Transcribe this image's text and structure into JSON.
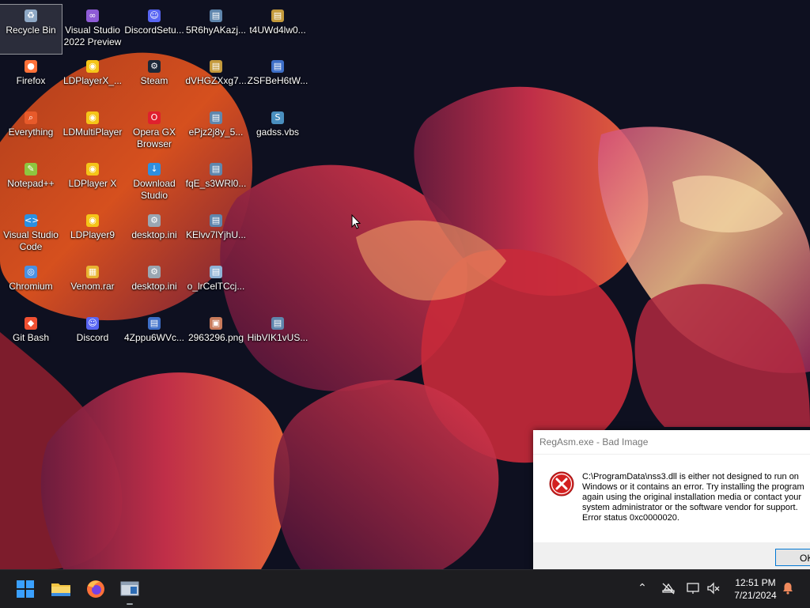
{
  "desktop": {
    "icons": [
      {
        "label": "Recycle Bin",
        "icon": "recycle-bin-icon",
        "color": "#8fa9c6",
        "selected": true
      },
      {
        "label": "Visual Studio\n2022 Preview",
        "icon": "visual-studio-icon",
        "color": "#8e5bd6"
      },
      {
        "label": "DiscordSetu...",
        "icon": "discord-icon",
        "color": "#5865f2"
      },
      {
        "label": "5R6hyAKazj...",
        "icon": "file-icon",
        "color": "#5f86ad"
      },
      {
        "label": "t4UWd4lw0...",
        "icon": "file-icon",
        "color": "#c49a3c"
      },
      {
        "label": "Firefox",
        "icon": "firefox-icon",
        "color": "#ff7139"
      },
      {
        "label": "LDPlayerX_...",
        "icon": "ldplayer-icon",
        "color": "#f5c518"
      },
      {
        "label": "Steam",
        "icon": "steam-icon",
        "color": "#1b2838"
      },
      {
        "label": "dVHGZXxg7...",
        "icon": "file-icon",
        "color": "#c49a3c"
      },
      {
        "label": "ZSFBeH6tW...",
        "icon": "file-icon",
        "color": "#3e6fc8"
      },
      {
        "label": "Everything",
        "icon": "everything-icon",
        "color": "#e85a2a"
      },
      {
        "label": "LDMultiPlayer",
        "icon": "ldmultiplayer-icon",
        "color": "#f5c518"
      },
      {
        "label": "Opera GX\nBrowser",
        "icon": "opera-gx-icon",
        "color": "#e0202e"
      },
      {
        "label": "ePjz2j8y_5...",
        "icon": "file-icon",
        "color": "#5f86ad"
      },
      {
        "label": "gadss.vbs",
        "icon": "script-icon",
        "color": "#4a8fbf"
      },
      {
        "label": "Notepad++",
        "icon": "notepad-plus-plus-icon",
        "color": "#8ec63f"
      },
      {
        "label": "LDPlayer X",
        "icon": "ldplayer-icon",
        "color": "#f5c518"
      },
      {
        "label": "Download\nStudio",
        "icon": "download-studio-icon",
        "color": "#2f8fe0"
      },
      {
        "label": "fqE_s3WRl0...",
        "icon": "file-icon",
        "color": "#5f86ad"
      },
      {
        "label": "",
        "icon": "",
        "color": ""
      },
      {
        "label": "Visual Studio\nCode",
        "icon": "vscode-icon",
        "color": "#2b8fe0"
      },
      {
        "label": "LDPlayer9",
        "icon": "ldplayer-icon",
        "color": "#f5c518"
      },
      {
        "label": "desktop.ini",
        "icon": "settings-file-icon",
        "color": "#9aa6b2"
      },
      {
        "label": "KElvv7lYjhU...",
        "icon": "file-icon",
        "color": "#5f86ad"
      },
      {
        "label": "",
        "icon": "",
        "color": ""
      },
      {
        "label": "Chromium",
        "icon": "chromium-icon",
        "color": "#4a90e2"
      },
      {
        "label": "Venom.rar",
        "icon": "archive-icon",
        "color": "#e8b432"
      },
      {
        "label": "desktop.ini",
        "icon": "settings-file-icon",
        "color": "#9aa6b2"
      },
      {
        "label": "o_lrCelTCcj...",
        "icon": "file-icon",
        "color": "#8fb3d6"
      },
      {
        "label": "",
        "icon": "",
        "color": ""
      },
      {
        "label": "Git Bash",
        "icon": "git-bash-icon",
        "color": "#f05032"
      },
      {
        "label": "Discord",
        "icon": "discord-icon",
        "color": "#5865f2"
      },
      {
        "label": "4Zppu6WVc...",
        "icon": "file-icon",
        "color": "#3e6fc8"
      },
      {
        "label": "2963296.png",
        "icon": "image-file-icon",
        "color": "#c87a5a"
      },
      {
        "label": "HibVIK1vUS...",
        "icon": "file-icon",
        "color": "#5f86ad"
      }
    ]
  },
  "dialog": {
    "title": "RegAsm.exe - Bad Image",
    "message_lines": [
      "C:\\ProgramData\\nss3.dll is either not designed to run on",
      "Windows or it contains an error. Try installing the program",
      "again using the original installation media or contact your",
      "system administrator or the software vendor for support.",
      "Error status 0xc0000020."
    ],
    "ok_label": "OK"
  },
  "taskbar": {
    "pinned": [
      {
        "icon": "windows-start-icon",
        "color": "#3aa0ff"
      },
      {
        "icon": "file-explorer-icon",
        "color": "#f4c542"
      },
      {
        "icon": "firefox-icon",
        "color": "#ff7139"
      },
      {
        "icon": "app-window-icon",
        "color": "#cfd8e3"
      }
    ],
    "tray": {
      "icons": [
        "chevron-up-icon",
        "network-off-icon",
        "display-icon",
        "volume-muted-icon",
        "notification-bell-icon"
      ],
      "time": "12:51 PM",
      "date": "7/21/2024"
    }
  }
}
